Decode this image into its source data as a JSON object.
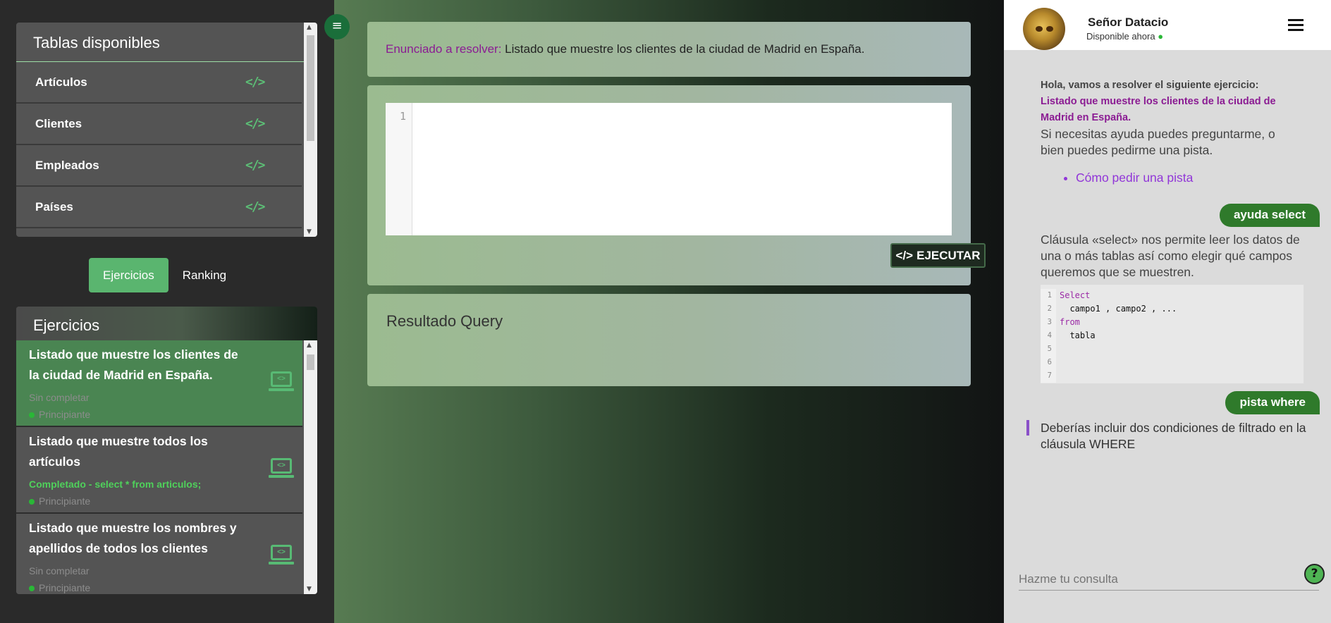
{
  "tables_panel": {
    "title": "Tablas disponibles",
    "items": [
      {
        "label": "Artículos",
        "icon": "code-icon"
      },
      {
        "label": "Clientes",
        "icon": "code-icon"
      },
      {
        "label": "Empleados",
        "icon": "code-icon"
      },
      {
        "label": "Países",
        "icon": "code-icon"
      }
    ]
  },
  "tabs": {
    "exercises": "Ejercicios",
    "ranking": "Ranking"
  },
  "exercises_panel": {
    "title": "Ejercicios",
    "items": [
      {
        "title": "Listado que muestre los clientes de la ciudad de Madrid en España.",
        "status": "Sin completar",
        "level": "Principiante"
      },
      {
        "title": "Listado que muestre todos los artículos",
        "status": "Completado - select * from articulos;",
        "level": "Principiante"
      },
      {
        "title": "Listado que muestre los nombres y apellidos de todos los clientes",
        "status": "Sin completar",
        "level": "Principiante"
      }
    ]
  },
  "statement": {
    "label": "Enunciado a resolver:",
    "text": " Listado que muestre los clientes de la ciudad de Madrid en España."
  },
  "editor": {
    "line_number": "1",
    "run_label": "EJECUTAR"
  },
  "result": {
    "title": "Resultado Query"
  },
  "chat": {
    "bot_name": "Señor Datacio",
    "bot_status": "Disponible ahora",
    "intro_1": "Hola, vamos a resolver el siguiente ejercicio:",
    "intro_exercise": "Listado que muestre los clientes de la ciudad de Madrid en España.",
    "intro_2": "Si necesitas ayuda puedes preguntarme, o bien puedes pedirme una pista.",
    "hint_link": "Cómo pedir una pista",
    "user_msg_1": "ayuda select",
    "bot_msg_2": "Cláusula «select» nos permite leer los datos de una o más tablas así como elegir qué campos queremos que se muestren.",
    "code_lines": [
      "Select",
      "  campo1 , campo2 , ...",
      "from",
      "  tabla",
      "",
      "",
      ""
    ],
    "user_msg_2": "pista where",
    "bot_msg_3": "Deberías incluir dos condiciones de filtrado en la cláusula WHERE",
    "input_placeholder": "Hazme tu consulta",
    "help_label": "?"
  },
  "colors": {
    "accent_green": "#5ab56f",
    "purple": "#8b1c93",
    "bubble_green": "#2f7a2b"
  }
}
